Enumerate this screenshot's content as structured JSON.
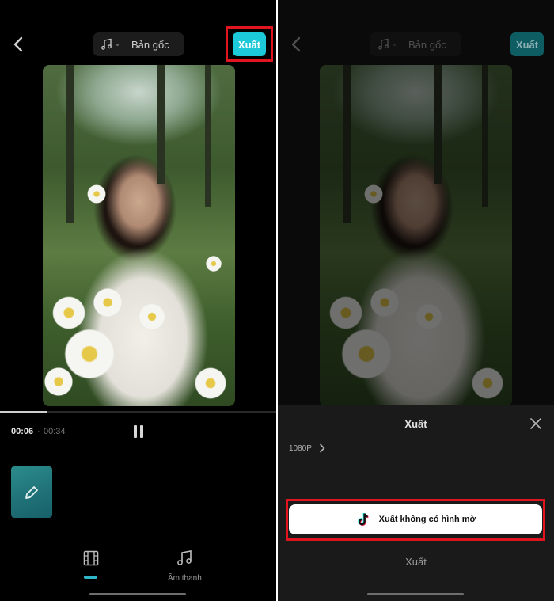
{
  "left_screen": {
    "audio_source_label": "Bản gốc",
    "export_label": "Xuất",
    "time_current": "00:06",
    "time_separator": "·",
    "time_total": "00:34",
    "playback_progress": 0.17,
    "bottom_tabs": [
      {
        "icon": "film-icon",
        "label": ""
      },
      {
        "icon": "music-note-icon",
        "label": "Âm thanh"
      }
    ],
    "active_tab": 0,
    "highlight_color": "#e01520",
    "accent_color": "#1cc9d8"
  },
  "right_screen": {
    "audio_source_label": "Bản gốc",
    "export_label": "Xuất",
    "sheet": {
      "title": "Xuất",
      "resolution": "1080P",
      "primary_button_label": "Xuất không có hình mờ",
      "secondary_button_label": "Xuất"
    }
  }
}
